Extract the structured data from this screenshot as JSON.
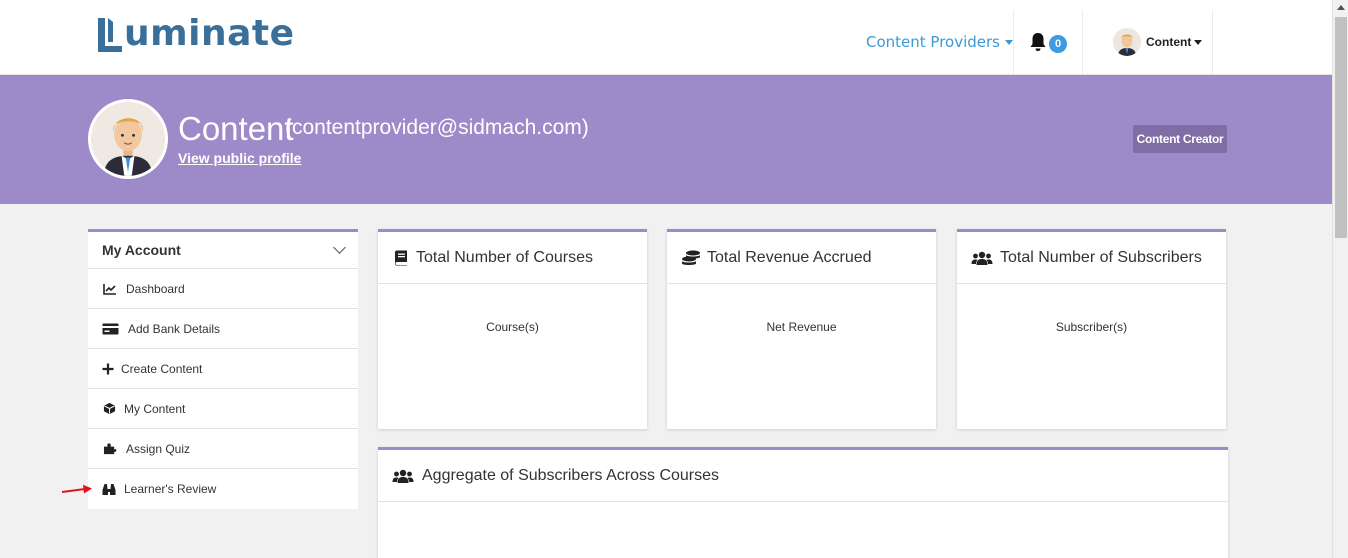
{
  "header": {
    "logo_text": "uminate",
    "nav_providers": "Content Providers",
    "notification_count": "0",
    "user_menu_label": "Content"
  },
  "profile": {
    "name": "Content",
    "email": "(contentprovider@sidmach.com)",
    "public_profile_link": "View public profile",
    "role_badge": "Content Creator"
  },
  "sidebar": {
    "title": "My Account",
    "items": [
      {
        "label": "Dashboard",
        "icon": "chart-line-icon"
      },
      {
        "label": "Add Bank Details",
        "icon": "credit-card-icon"
      },
      {
        "label": "Create Content",
        "icon": "plus-icon"
      },
      {
        "label": "My Content",
        "icon": "cube-icon"
      },
      {
        "label": "Assign Quiz",
        "icon": "puzzle-icon"
      },
      {
        "label": "Learner's Review",
        "icon": "binoculars-icon"
      }
    ]
  },
  "cards": [
    {
      "title": "Total Number of Courses",
      "body": "Course(s)",
      "icon": "book-icon"
    },
    {
      "title": "Total Revenue Accrued",
      "body": "Net Revenue",
      "icon": "coins-icon"
    },
    {
      "title": "Total Number of Subscribers",
      "body": "Subscriber(s)",
      "icon": "users-icon"
    }
  ],
  "aggregate_card": {
    "title": "Aggregate of Subscribers Across Courses",
    "icon": "users-icon"
  },
  "colors": {
    "banner": "#9c8bc8",
    "accent_blue": "#3b9ad6",
    "logo": "#3a6f99",
    "annotation_arrow": "#e0151a"
  }
}
